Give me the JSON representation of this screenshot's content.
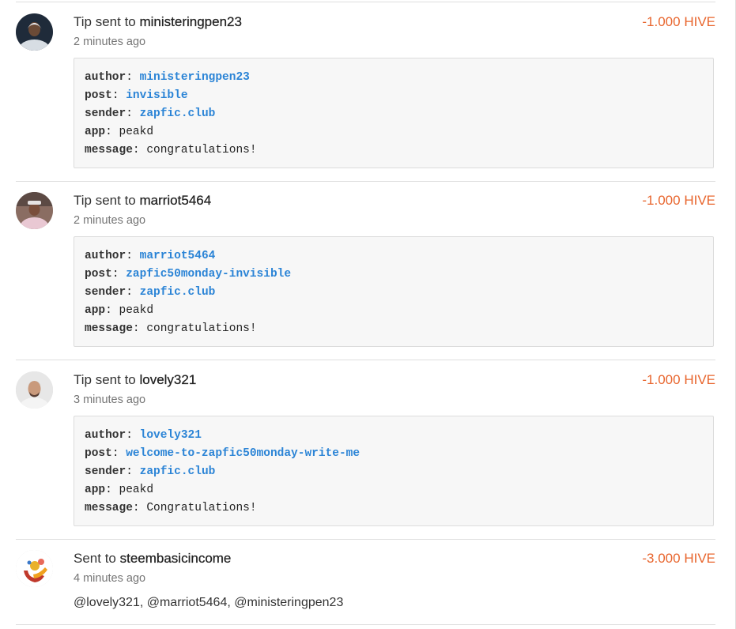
{
  "entries": [
    {
      "prefix": "Tip sent to ",
      "user": "ministeringpen23",
      "amount": "-1.000 HIVE",
      "time": "2 minutes ago",
      "memo": {
        "author_key": "author",
        "author": "ministeringpen23",
        "post_key": "post",
        "post": "invisible",
        "sender_key": "sender",
        "sender": "zapfic.club",
        "app_key": "app",
        "app": "peakd",
        "message_key": "message",
        "message": "congratulations!"
      }
    },
    {
      "prefix": "Tip sent to ",
      "user": "marriot5464",
      "amount": "-1.000 HIVE",
      "time": "2 minutes ago",
      "memo": {
        "author_key": "author",
        "author": "marriot5464",
        "post_key": "post",
        "post": "zapfic50monday-invisible",
        "sender_key": "sender",
        "sender": "zapfic.club",
        "app_key": "app",
        "app": "peakd",
        "message_key": "message",
        "message": "congratulations!"
      }
    },
    {
      "prefix": "Tip sent to ",
      "user": "lovely321",
      "amount": "-1.000 HIVE",
      "time": "3 minutes ago",
      "memo": {
        "author_key": "author",
        "author": "lovely321",
        "post_key": "post",
        "post": "welcome-to-zapfic50monday-write-me",
        "sender_key": "sender",
        "sender": "zapfic.club",
        "app_key": "app",
        "app": "peakd",
        "message_key": "message",
        "message": "Congratulations!"
      }
    },
    {
      "prefix": "Sent to ",
      "user": "steembasicincome",
      "amount": "-3.000 HIVE",
      "time": "4 minutes ago",
      "text": "@lovely321, @marriot5464, @ministeringpen23"
    }
  ],
  "colors": {
    "amount": "#e8652d",
    "link": "#2b84d6",
    "memo_bg": "#f7f7f7",
    "divider": "#dedede"
  },
  "icons": {
    "avatar_1": "user-avatar-icon",
    "avatar_2": "user-avatar-icon",
    "avatar_3": "user-avatar-icon",
    "avatar_4": "hand-heart-logo-icon"
  }
}
